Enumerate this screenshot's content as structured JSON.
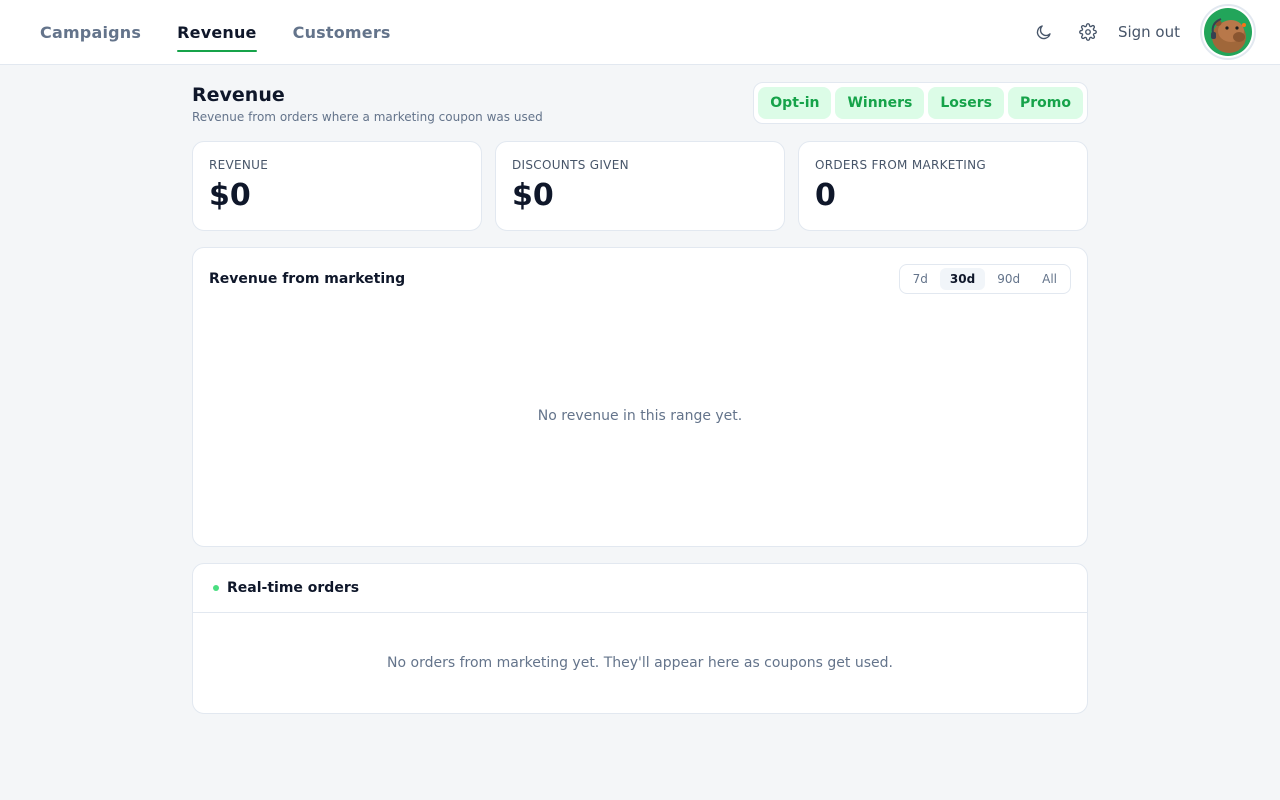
{
  "nav": {
    "items": [
      {
        "label": "Campaigns",
        "active": false
      },
      {
        "label": "Revenue",
        "active": true
      },
      {
        "label": "Customers",
        "active": false
      }
    ]
  },
  "header": {
    "theme_icon": "moon-icon",
    "settings_icon": "gear-icon",
    "sign_out_label": "Sign out",
    "avatar_icon": "capybara-avatar-icon"
  },
  "page": {
    "title": "Revenue",
    "subtitle": "Revenue from orders where a marketing coupon was used",
    "filters": [
      "Opt-in",
      "Winners",
      "Losers",
      "Promo"
    ]
  },
  "stats": [
    {
      "label": "REVENUE",
      "value": "$0"
    },
    {
      "label": "DISCOUNTS GIVEN",
      "value": "$0"
    },
    {
      "label": "ORDERS FROM MARKETING",
      "value": "0"
    }
  ],
  "chart": {
    "title": "Revenue from marketing",
    "ranges": [
      "7d",
      "30d",
      "90d",
      "All"
    ],
    "selected_range": "30d",
    "empty_message": "No revenue in this range yet."
  },
  "orders": {
    "title": "Real-time orders",
    "empty_message": "No orders from marketing yet. They'll appear here as coupons get used."
  },
  "colors": {
    "accent": "#16a34a",
    "chip_bg": "#dcfce7",
    "live_dot": "#4ade80"
  }
}
